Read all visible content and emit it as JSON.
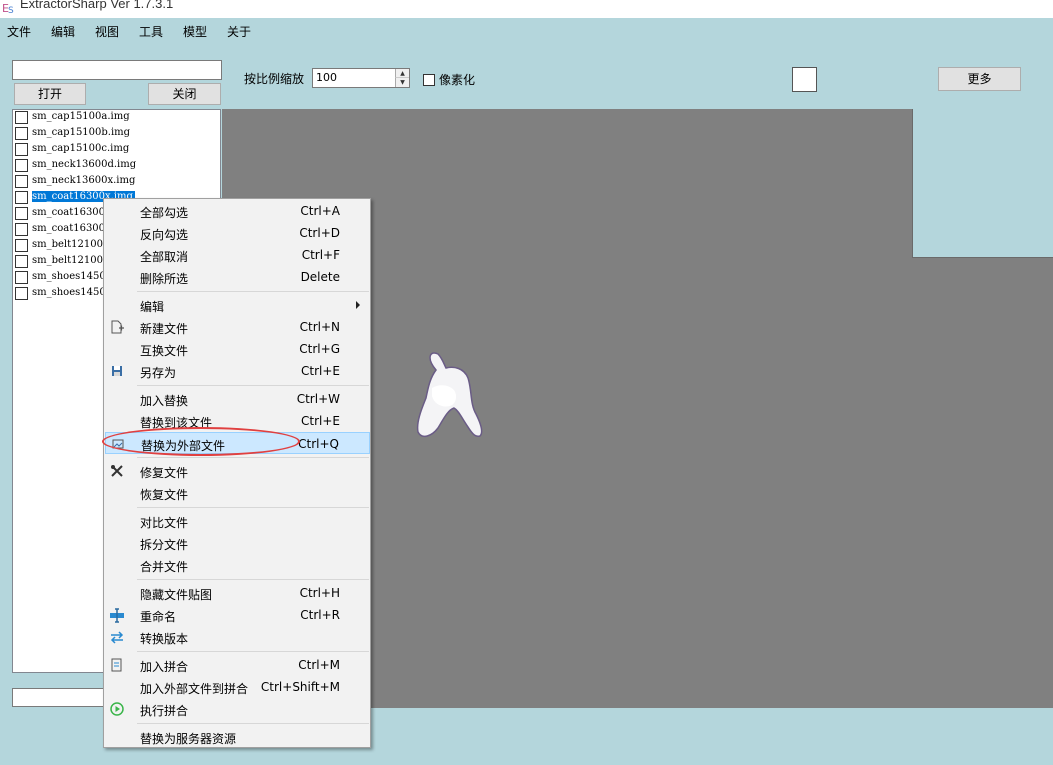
{
  "window": {
    "title": "ExtractorSharp Ver 1.7.3.1"
  },
  "menubar": [
    {
      "label": "文件"
    },
    {
      "label": "编辑"
    },
    {
      "label": "视图"
    },
    {
      "label": "工具"
    },
    {
      "label": "模型"
    },
    {
      "label": "关于"
    }
  ],
  "toolbar": {
    "search_value": "",
    "open_label": "打开",
    "close_label": "关闭",
    "scale_label": "按比例缩放",
    "scale_value": "100",
    "pixelate_label": "像素化",
    "more_label": "更多",
    "color_swatch": "#ffffff"
  },
  "files": [
    {
      "name": "sm_cap15100a.img",
      "selected": false
    },
    {
      "name": "sm_cap15100b.img",
      "selected": false
    },
    {
      "name": "sm_cap15100c.img",
      "selected": false
    },
    {
      "name": "sm_neck13600d.img",
      "selected": false
    },
    {
      "name": "sm_neck13600x.img",
      "selected": false
    },
    {
      "name": "sm_coat16300x.img",
      "selected": true
    },
    {
      "name": "sm_coat16300",
      "selected": false
    },
    {
      "name": "sm_coat16300",
      "selected": false
    },
    {
      "name": "sm_belt12100",
      "selected": false
    },
    {
      "name": "sm_belt12100",
      "selected": false
    },
    {
      "name": "sm_shoes1450",
      "selected": false
    },
    {
      "name": "sm_shoes1450",
      "selected": false
    }
  ],
  "context_menu": {
    "items": [
      {
        "label": "全部勾选",
        "shortcut": "Ctrl+A",
        "icon": ""
      },
      {
        "label": "反向勾选",
        "shortcut": "Ctrl+D",
        "icon": ""
      },
      {
        "label": "全部取消",
        "shortcut": "Ctrl+F",
        "icon": ""
      },
      {
        "label": "删除所选",
        "shortcut": "Delete",
        "icon": ""
      },
      {
        "label": "编辑",
        "shortcut": "",
        "icon": "",
        "submenu": true
      },
      {
        "label": "新建文件",
        "shortcut": "Ctrl+N",
        "icon": "new-file-icon"
      },
      {
        "label": "互换文件",
        "shortcut": "Ctrl+G",
        "icon": ""
      },
      {
        "label": "另存为",
        "shortcut": "Ctrl+E",
        "icon": "save-icon"
      },
      {
        "label": "加入替换",
        "shortcut": "Ctrl+W",
        "icon": ""
      },
      {
        "label": "替换到该文件",
        "shortcut": "Ctrl+E",
        "icon": ""
      },
      {
        "label": "替换为外部文件",
        "shortcut": "Ctrl+Q",
        "icon": "replace-image-icon",
        "highlighted": true
      },
      {
        "label": "修复文件",
        "shortcut": "",
        "icon": "tools-icon"
      },
      {
        "label": "恢复文件",
        "shortcut": "",
        "icon": ""
      },
      {
        "label": "对比文件",
        "shortcut": "",
        "icon": ""
      },
      {
        "label": "拆分文件",
        "shortcut": "",
        "icon": ""
      },
      {
        "label": "合并文件",
        "shortcut": "",
        "icon": ""
      },
      {
        "label": "隐藏文件贴图",
        "shortcut": "Ctrl+H",
        "icon": ""
      },
      {
        "label": "重命名",
        "shortcut": "Ctrl+R",
        "icon": "rename-icon"
      },
      {
        "label": "转换版本",
        "shortcut": "",
        "icon": "convert-arrows-icon"
      },
      {
        "label": "加入拼合",
        "shortcut": "Ctrl+M",
        "icon": "merge-doc-icon"
      },
      {
        "label": "加入外部文件到拼合",
        "shortcut": "Ctrl+Shift+M",
        "icon": ""
      },
      {
        "label": "执行拼合",
        "shortcut": "",
        "icon": "play-circle-icon"
      },
      {
        "label": "替换为服务器资源",
        "shortcut": "",
        "icon": ""
      }
    ]
  },
  "colors": {
    "background": "#b4d6dc",
    "canvas": "#808080",
    "selection": "#0078d7",
    "menu_highlight": "#cce8ff",
    "annotation": "#e04040"
  }
}
